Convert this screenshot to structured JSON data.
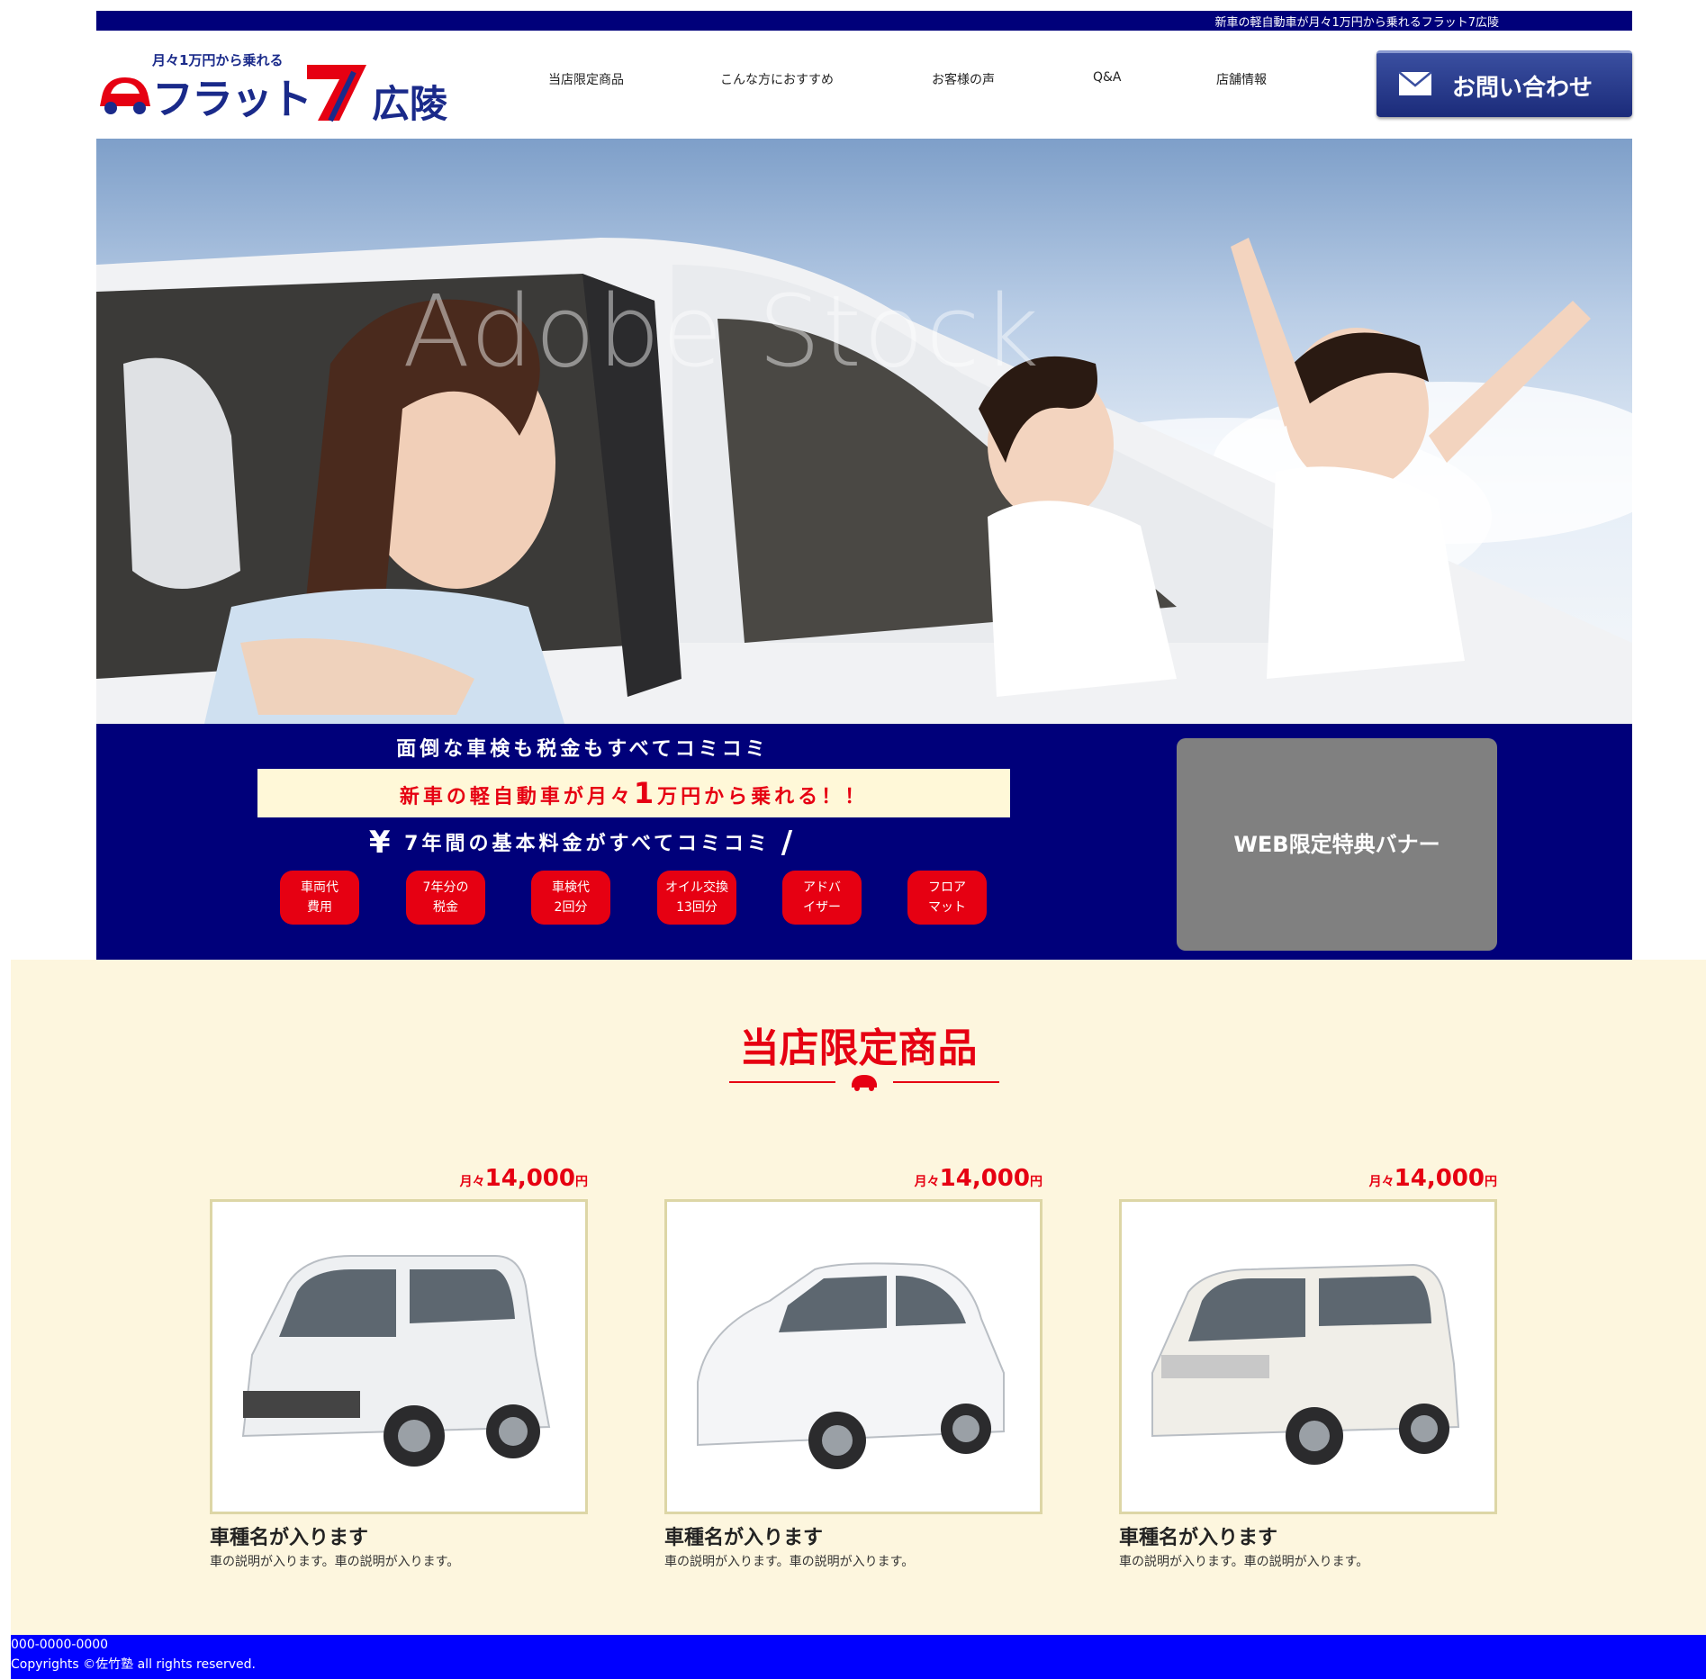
{
  "topbar": {
    "text": "新車の軽自動車が月々1万円から乗れるフラット7広陵"
  },
  "logo": {
    "tagline": "月々1万円から乗れる",
    "brand": "フラット",
    "city": "広陵"
  },
  "nav": [
    {
      "label": "当店限定商品"
    },
    {
      "label": "こんな方におすすめ"
    },
    {
      "label": "お客様の声"
    },
    {
      "label": "Q&A"
    },
    {
      "label": "店舗情報"
    }
  ],
  "contact": {
    "label": "お問い合わせ"
  },
  "hero": {
    "watermark": "Adobe Stock"
  },
  "band": {
    "line1": "面倒な車検も税金もすべてコミコミ",
    "line2_pre": "新車の軽自動車が月々",
    "line2_num": "1",
    "line2_post": "万円から乗れる！！",
    "line3_yen": "¥",
    "line3": "7年間の基本料金がすべてコミコミ",
    "line3_slash": "/",
    "badges": [
      {
        "l1": "車両代",
        "l2": "費用"
      },
      {
        "l1": "7年分の",
        "l2": "税金"
      },
      {
        "l1": "車検代",
        "l2": "2回分"
      },
      {
        "l1": "オイル交換",
        "l2": "13回分"
      },
      {
        "l1": "アドバ",
        "l2": "イザー"
      },
      {
        "l1": "フロア",
        "l2": "マット"
      }
    ],
    "web_banner": "WEB限定特典バナー"
  },
  "products": {
    "title": "当店限定商品",
    "items": [
      {
        "price_pre": "月々",
        "price": "14,000",
        "price_post": "円",
        "name": "車種名が入ります",
        "desc": "車の説明が入ります。車の説明が入ります。"
      },
      {
        "price_pre": "月々",
        "price": "14,000",
        "price_post": "円",
        "name": "車種名が入ります",
        "desc": "車の説明が入ります。車の説明が入ります。"
      },
      {
        "price_pre": "月々",
        "price": "14,000",
        "price_post": "円",
        "name": "車種名が入ります",
        "desc": "車の説明が入ります。車の説明が入ります。"
      }
    ]
  },
  "footer": {
    "phone": "000-0000-0000",
    "copyright": "Copyrights ©佐竹塾 all rights reserved."
  },
  "colors": {
    "navy": "#00007a",
    "red": "#e60012",
    "cream": "#fdf6de",
    "footer": "#0000ff",
    "banner_gray": "#808080"
  }
}
